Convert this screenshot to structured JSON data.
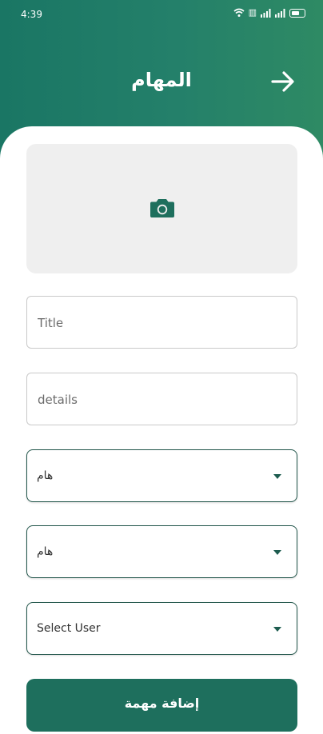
{
  "status_bar": {
    "time": "4:39",
    "icons": [
      "wifi-icon",
      "hd-signal-icon",
      "signal-icon",
      "signal-icon",
      "battery-icon"
    ]
  },
  "header": {
    "title": "المهام",
    "back_icon": "arrow-right-icon",
    "gradient_colors": [
      "#1a7664",
      "#2e8a64"
    ]
  },
  "form": {
    "image_picker_icon": "camera-icon",
    "title_field": {
      "placeholder": "Title",
      "value": ""
    },
    "details_field": {
      "placeholder": "details",
      "value": ""
    },
    "select_1": {
      "value": "هام"
    },
    "select_2": {
      "value": "هام"
    },
    "select_user": {
      "value": "Select User"
    },
    "submit_label": "إضافة مهمة"
  },
  "colors": {
    "accent": "#1e6f5d",
    "picker_bg": "#efefef"
  }
}
